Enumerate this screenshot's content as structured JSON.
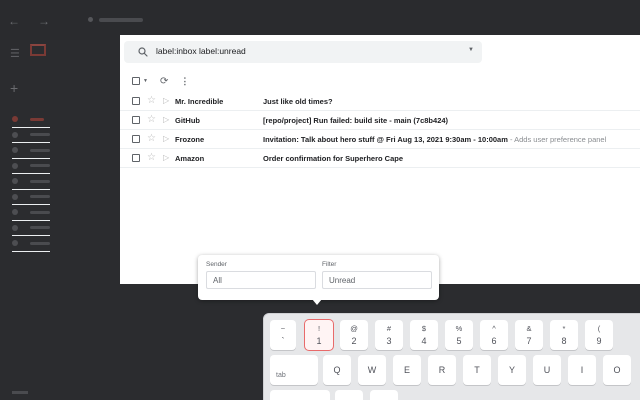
{
  "search": {
    "query": "label:inbox label:unread"
  },
  "emails": [
    {
      "sender": "Mr. Incredible",
      "subject": "Just like old times?",
      "snippet": ""
    },
    {
      "sender": "GitHub",
      "subject": "[repo/project] Run failed: build site - main (7c8b424)",
      "snippet": ""
    },
    {
      "sender": "Frozone",
      "subject": "Invitation: Talk about hero stuff @ Fri Aug 13, 2021 9:30am - 10:00am",
      "snippet": " - Adds user preference panel"
    },
    {
      "sender": "Amazon",
      "subject": "Order confirmation for Superhero Cape",
      "snippet": ""
    }
  ],
  "popup": {
    "sender_label": "Sender",
    "sender_value": "All",
    "filter_label": "Filter",
    "filter_value": "Unread"
  },
  "keyboard": {
    "number_row": [
      {
        "top": "~",
        "bottom": "`"
      },
      {
        "top": "!",
        "bottom": "1"
      },
      {
        "top": "@",
        "bottom": "2"
      },
      {
        "top": "#",
        "bottom": "3"
      },
      {
        "top": "$",
        "bottom": "4"
      },
      {
        "top": "%",
        "bottom": "5"
      },
      {
        "top": "^",
        "bottom": "6"
      },
      {
        "top": "&",
        "bottom": "7"
      },
      {
        "top": "*",
        "bottom": "8"
      },
      {
        "top": "(",
        "bottom": "9"
      }
    ],
    "tab_label": "tab",
    "letter_row": [
      "Q",
      "W",
      "E",
      "R",
      "T",
      "Y",
      "U",
      "I",
      "O"
    ]
  },
  "colors": {
    "highlight": "#e86a6a",
    "panel": "#ffffff",
    "background": "#2b2c2f"
  }
}
